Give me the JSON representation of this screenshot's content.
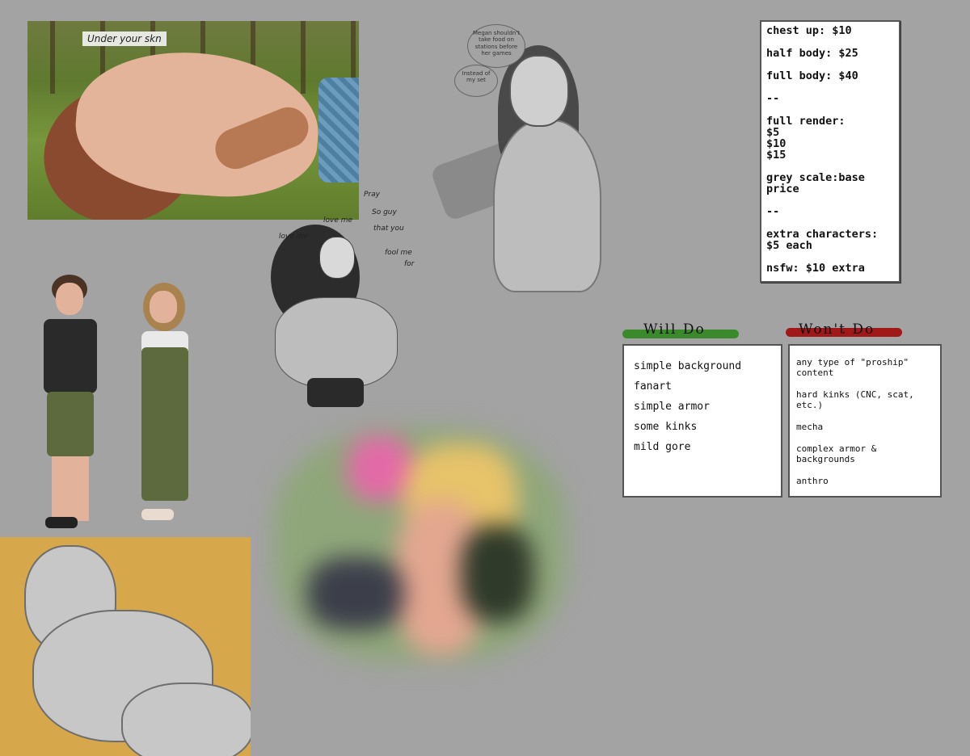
{
  "artworks": {
    "grass": {
      "caption": "Under your skn"
    },
    "sketch": {
      "note_1": "Megan shouldn't take food on stations before her games",
      "note_2": "Instead of my set"
    },
    "seated": {
      "lyrics": [
        "Pray",
        "So guy",
        "that you",
        "love me",
        "love me",
        "fool me",
        "for"
      ]
    }
  },
  "price_list": {
    "lines": [
      "chest up: $10",
      "",
      "half body: $25",
      "",
      "full body: $40",
      "",
      "--",
      "",
      "full render:",
      "$5",
      "$10",
      "$15",
      "",
      "grey scale:base",
      "price",
      "",
      "--",
      "",
      "extra characters:",
      "$5 each",
      "",
      "nsfw: $10 extra"
    ]
  },
  "will_do": {
    "title": "Will Do",
    "accent": "#3a8a2c",
    "items": [
      "simple background",
      "fanart",
      "simple armor",
      "some kinks",
      "mild gore"
    ]
  },
  "wont_do": {
    "title": "Won't Do",
    "accent": "#a01818",
    "items": [
      "any type of \"proship\" content",
      "hard kinks (CNC, scat, etc.)",
      "mecha",
      "complex armor & backgrounds",
      "anthro"
    ]
  }
}
